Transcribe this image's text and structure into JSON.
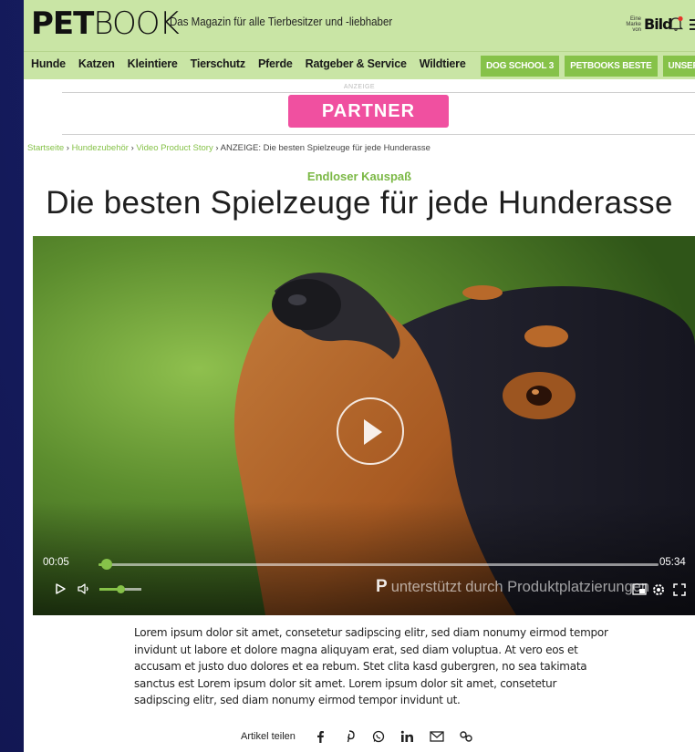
{
  "header": {
    "logo_bold": "PET",
    "logo_thin": "BOOK",
    "tagline": "Das Magazin für alle Tierbesitzer und -liebhaber",
    "brand_small": "Eine Marke von",
    "brand_name": "Bild"
  },
  "nav": {
    "items": [
      "Hunde",
      "Katzen",
      "Kleintiere",
      "Tierschutz",
      "Pferde",
      "Ratgeber & Service",
      "Wildtiere"
    ],
    "pills": [
      "DOG SCHOOL 3",
      "PETBOOKS BESTE",
      "UNSER TV SPO"
    ]
  },
  "ad": {
    "label": "ANZEIGE",
    "partner_button": "PARTNER"
  },
  "breadcrumb": {
    "items": [
      "Startseite",
      "Hundezubehör",
      "Video Product Story"
    ],
    "current": "ANZEIGE: Die besten Spielzeuge für jede Hunderasse",
    "separator": "›"
  },
  "article": {
    "kicker": "Endloser Kauspaß",
    "title": "Die besten Spielzeuge für jede Hunderasse",
    "body": "Lorem ipsum dolor sit amet, consetetur sadipscing elitr, sed diam nonumy eirmod tempor invidunt ut labore et dolore magna aliquyam erat, sed diam voluptua. At vero eos et accusam et justo duo dolores et ea rebum. Stet clita kasd gubergren, no sea takimata sanctus est Lorem ipsum dolor sit amet. Lorem ipsum dolor sit amet, consetetur sadipscing elitr, sed diam nonumy eirmod tempor invidunt ut."
  },
  "video": {
    "current_time": "00:05",
    "duration": "05:34",
    "progress_fraction": 0.015,
    "volume_fraction": 0.5,
    "placement_mark": "P",
    "placement_text": "unterstützt durch Produktplatzierungen"
  },
  "share": {
    "label": "Artikel teilen",
    "icons": [
      "facebook-icon",
      "pinterest-icon",
      "whatsapp-icon",
      "linkedin-icon",
      "email-icon",
      "link-icon"
    ]
  },
  "colors": {
    "header_bg": "#c9e5a5",
    "accent_green": "#86c249",
    "partner_pink": "#f050a0",
    "page_bg": "#171e63"
  }
}
